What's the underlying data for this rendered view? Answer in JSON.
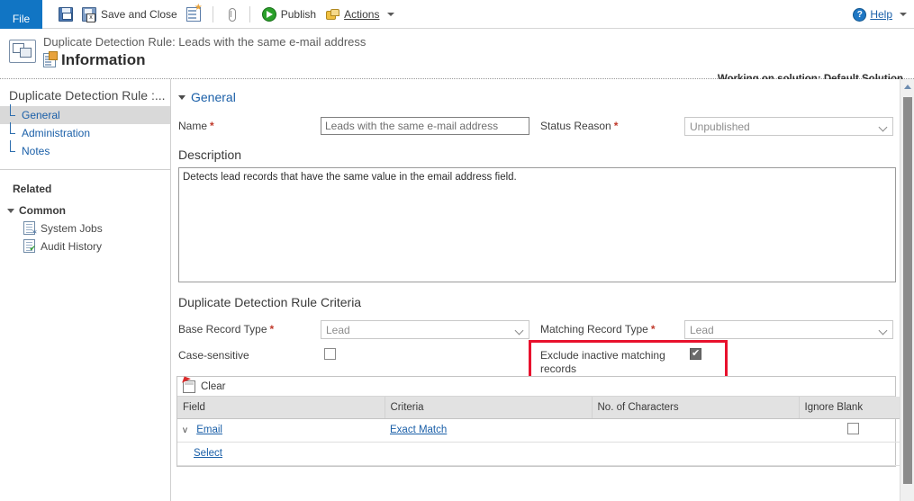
{
  "ribbon": {
    "file_tab": "File",
    "save_icon": "save-icon",
    "save_close_icon": "save-and-close-icon",
    "save_close_label": "Save and Close",
    "new_record_icon": "new-record-icon",
    "attach_icon": "paperclip-icon",
    "publish_icon": "publish-icon",
    "publish_label": "Publish",
    "actions_icon": "actions-icon",
    "actions_label": "Actions",
    "help_icon": "help-icon",
    "help_label": "Help"
  },
  "header": {
    "entity_icon": "duplicate-detection-rule-icon",
    "breadcrumb": "Duplicate Detection Rule: Leads with the same e-mail address",
    "page_icon": "information-form-icon",
    "page_title": "Information",
    "solution_note": "Working on solution: Default Solution"
  },
  "sidebar": {
    "title": "Duplicate Detection Rule :...",
    "items": [
      {
        "label": "General",
        "selected": true
      },
      {
        "label": "Administration",
        "selected": false
      },
      {
        "label": "Notes",
        "selected": false
      }
    ],
    "related_label": "Related",
    "groups": [
      {
        "label": "Common",
        "items": [
          {
            "label": "System Jobs",
            "icon": "system-jobs-icon"
          },
          {
            "label": "Audit History",
            "icon": "audit-history-icon"
          }
        ]
      }
    ]
  },
  "form": {
    "general_section": "General",
    "name_label": "Name",
    "name_value": "Leads with the same e-mail address",
    "status_reason_label": "Status Reason",
    "status_reason_value": "Unpublished",
    "description_label": "Description",
    "description_value": "Detects lead records that have the same value in the email address field.",
    "criteria_header": "Duplicate Detection Rule Criteria",
    "base_record_type_label": "Base Record Type",
    "base_record_type_value": "Lead",
    "matching_record_type_label": "Matching Record Type",
    "matching_record_type_value": "Lead",
    "case_sensitive_label": "Case-sensitive",
    "case_sensitive_checked": false,
    "exclude_inactive_label": "Exclude inactive matching records",
    "exclude_inactive_checked": true,
    "required_marker": "*"
  },
  "criteria_grid": {
    "toolbar": {
      "clear_icon": "clear-icon",
      "clear_label": "Clear"
    },
    "columns": [
      "Field",
      "Criteria",
      "No. of Characters",
      "Ignore Blank"
    ],
    "rows": [
      {
        "expander": "v",
        "field": "Email",
        "criteria": "Exact Match",
        "no_of_characters": "",
        "ignore_blank_checked": false
      }
    ],
    "add_row_label": "Select"
  },
  "colors": {
    "file_tab_blue": "#1175c4",
    "link_blue": "#1a5fa8",
    "required_red": "#c0392b",
    "highlight_red": "#e8112d",
    "grid_header_gray": "#e2e2e2",
    "selected_nav_gray": "#d9d9d9"
  }
}
